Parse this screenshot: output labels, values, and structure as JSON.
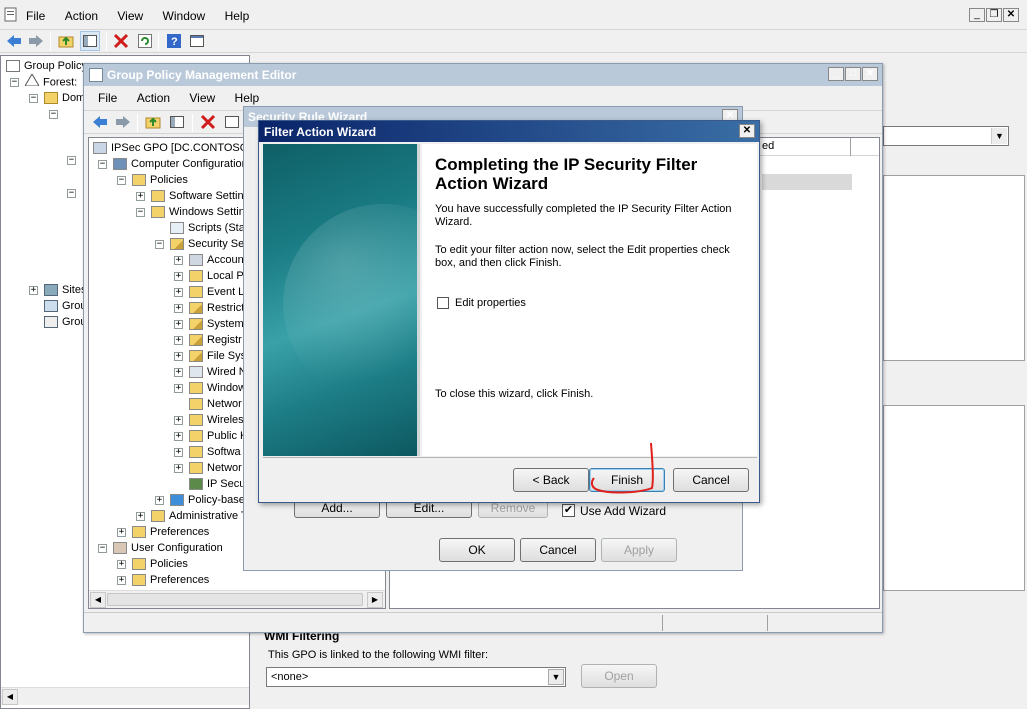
{
  "main": {
    "menu": [
      "File",
      "Action",
      "View",
      "Window",
      "Help"
    ],
    "tree": {
      "root": "Group Policy",
      "forest": "Forest:",
      "domains": "Dom",
      "sites": "Sites",
      "group1": "Grou",
      "group2": "Grou"
    },
    "wmi_title": "WMI Filtering",
    "wmi_desc": "This GPO is linked to the following WMI filter:",
    "wmi_value": "<none>",
    "open_label": "Open"
  },
  "gpme": {
    "title": "Group Policy Management Editor",
    "menu": [
      "File",
      "Action",
      "View",
      "Help"
    ],
    "tree": [
      {
        "label": "IPSec GPO [DC.CONTOSO.",
        "icon": "gpo-icon"
      },
      {
        "label": "Computer Configuration",
        "icon": "computer-icon"
      },
      {
        "label": "Policies",
        "icon": "folder-icon"
      },
      {
        "label": "Software Settin",
        "icon": "folder-icon"
      },
      {
        "label": "Windows Settin",
        "icon": "folder-icon"
      },
      {
        "label": "Scripts (Sta",
        "icon": "script-icon"
      },
      {
        "label": "Security Se",
        "icon": "security-icon"
      },
      {
        "label": "Accoun",
        "icon": "account-icon"
      },
      {
        "label": "Local Po",
        "icon": "folder-icon"
      },
      {
        "label": "Event L",
        "icon": "folder-icon"
      },
      {
        "label": "Restrict",
        "icon": "folder-lock-icon"
      },
      {
        "label": "System",
        "icon": "folder-lock-icon"
      },
      {
        "label": "Registr",
        "icon": "folder-lock-icon"
      },
      {
        "label": "File Sys",
        "icon": "folder-lock-icon"
      },
      {
        "label": "Wired N",
        "icon": "network-icon"
      },
      {
        "label": "Window",
        "icon": "folder-icon"
      },
      {
        "label": "Networ",
        "icon": "folder-icon"
      },
      {
        "label": "Wireles",
        "icon": "folder-icon"
      },
      {
        "label": "Public K",
        "icon": "folder-icon"
      },
      {
        "label": "Softwa",
        "icon": "folder-icon"
      },
      {
        "label": "Networ",
        "icon": "folder-icon"
      },
      {
        "label": "IP Secu",
        "icon": "ipsec-icon"
      },
      {
        "label": "Policy-base",
        "icon": "chart-icon"
      },
      {
        "label": "Administrative Template",
        "icon": "folder-icon"
      },
      {
        "label": "Preferences",
        "icon": "folder-icon"
      },
      {
        "label": "User Configuration",
        "icon": "user-icon"
      },
      {
        "label": "Policies",
        "icon": "folder-icon"
      },
      {
        "label": "Preferences",
        "icon": "folder-icon"
      }
    ],
    "column_header_right": "ed"
  },
  "rule_wizard": {
    "title": "Security Rule Wizard",
    "add_label": "Add...",
    "edit_label": "Edit...",
    "remove_label": "Remove",
    "use_add_wizard": "Use Add Wizard",
    "ok_label": "OK",
    "cancel_label": "Cancel",
    "apply_label": "Apply"
  },
  "filter_wizard": {
    "title": "Filter Action Wizard",
    "heading": "Completing the IP Security Filter Action Wizard",
    "para1": "You have successfully completed the IP Security Filter Action Wizard.",
    "para2": "To edit your filter action now, select the Edit properties check box, and then click Finish.",
    "edit_properties": "Edit properties",
    "close_text": "To close this wizard, click Finish.",
    "back_label": "< Back",
    "finish_label": "Finish",
    "cancel_label": "Cancel",
    "annotation_color": "#e0201c",
    "banner_color": "#1a7c84"
  }
}
